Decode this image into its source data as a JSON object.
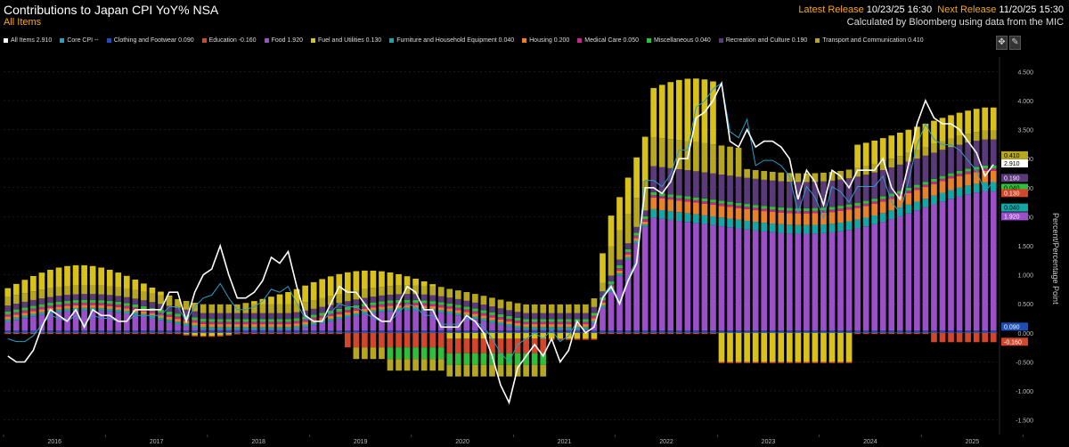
{
  "header": {
    "title": "Contributions to Japan CPI YoY% NSA",
    "subtitle": "All Items",
    "latest_release_label": "Latest Release",
    "latest_release_value": "10/23/25 16:30",
    "next_release_label": "Next Release",
    "next_release_value": "11/20/25 15:30",
    "calc_note": "Calculated by Bloomberg using data from the MIC"
  },
  "tools": {
    "zoom_icon": "crosshair-move-icon",
    "pin_icon": "pin-icon"
  },
  "chart_data": {
    "type": "bar",
    "stacked": true,
    "title": "Contributions to Japan CPI YoY% NSA",
    "ylabel": "Percent/Percentage Point",
    "ylim": [
      -1.75,
      4.75
    ],
    "yticks": [
      -1.5,
      -1.0,
      -0.5,
      0.0,
      0.5,
      1.0,
      1.5,
      2.0,
      2.5,
      3.0,
      3.5,
      4.0,
      4.5
    ],
    "ytick_labels": [
      "-1.500",
      "-1.000",
      "-0.500",
      "0.000",
      "0.500",
      "1.000",
      "1.500",
      "2.000",
      "2.500",
      "3.000",
      "3.500",
      "4.000",
      "4.500"
    ],
    "x_start": "2016-01",
    "x_end": "2025-09",
    "year_labels": [
      "2016",
      "2017",
      "2018",
      "2019",
      "2020",
      "2021",
      "2022",
      "2023",
      "2024",
      "2025"
    ],
    "grid": true,
    "legend_position": "top",
    "legend": [
      {
        "name": "All Items",
        "value": "2.910",
        "color": "#ffffff"
      },
      {
        "name": "Core CPI",
        "value": "--",
        "color": "#27a0c9"
      },
      {
        "name": "Clothing and Footwear",
        "value": "0.090",
        "color": "#1f4fb5"
      },
      {
        "name": "Education",
        "value": "-0.160",
        "color": "#d2462c"
      },
      {
        "name": "Food",
        "value": "1.920",
        "color": "#9b4fc9"
      },
      {
        "name": "Fuel and Utilities",
        "value": "0.130",
        "color": "#d8c21a"
      },
      {
        "name": "Furniture and Household Equipment",
        "value": "0.040",
        "color": "#15a6a6"
      },
      {
        "name": "Housing",
        "value": "0.200",
        "color": "#e8822a"
      },
      {
        "name": "Medical Care",
        "value": "0.050",
        "color": "#c2298f"
      },
      {
        "name": "Miscellaneous",
        "value": "0.040",
        "color": "#2fbf3a"
      },
      {
        "name": "Recreation and Culture",
        "value": "0.190",
        "color": "#5a3a78"
      },
      {
        "name": "Transport and Communication",
        "value": "0.410",
        "color": "#b7a61f"
      }
    ],
    "right_labels": [
      {
        "value": "0.410",
        "color": "#b7a61f",
        "y": 3.05
      },
      {
        "value": "2.910",
        "color": "#ffffff",
        "y": 2.91
      },
      {
        "value": "0.190",
        "color": "#5a3a78",
        "y": 2.66
      },
      {
        "value": "0.040",
        "color": "#2fbf3a",
        "y": 2.49
      },
      {
        "value": "0.130",
        "color": "#d2462c",
        "y": 2.4
      },
      {
        "value": "0.040",
        "color": "#15a6a6",
        "y": 2.15
      },
      {
        "value": "1.920",
        "color": "#9b4fc9",
        "y": 2.0
      },
      {
        "value": "0.090",
        "color": "#1f4fb5",
        "y": 0.1
      },
      {
        "value": "-0.160",
        "color": "#d2462c",
        "y": -0.16
      }
    ],
    "categories_order": [
      "Clothing and Footwear",
      "Food",
      "Furniture and Household Equipment",
      "Housing",
      "Medical Care",
      "Miscellaneous",
      "Recreation and Culture",
      "Fuel and Utilities",
      "Transport and Communication",
      "Education"
    ],
    "all_items": [
      -0.4,
      -0.5,
      -0.5,
      -0.3,
      0.1,
      0.4,
      0.3,
      0.2,
      0.4,
      0.1,
      0.4,
      0.3,
      0.3,
      0.2,
      0.2,
      0.4,
      0.4,
      0.4,
      0.4,
      0.7,
      0.7,
      0.2,
      0.7,
      1.0,
      1.1,
      1.5,
      1.0,
      0.6,
      0.6,
      0.7,
      0.9,
      1.3,
      1.2,
      1.4,
      0.8,
      0.3,
      0.2,
      0.2,
      0.5,
      0.8,
      0.7,
      0.7,
      0.5,
      0.3,
      0.2,
      0.2,
      0.5,
      0.8,
      0.7,
      0.4,
      0.4,
      0.1,
      0.1,
      0.1,
      0.3,
      0.2,
      0.0,
      -0.4,
      -0.9,
      -1.2,
      -0.6,
      -0.4,
      -0.2,
      -0.4,
      -0.1,
      -0.5,
      -0.3,
      0.2,
      0.0,
      0.1,
      0.6,
      0.8,
      0.5,
      0.9,
      1.2,
      2.5,
      2.5,
      2.4,
      2.6,
      3.0,
      3.0,
      3.7,
      3.8,
      4.0,
      4.3,
      3.3,
      3.2,
      3.5,
      3.2,
      3.3,
      3.3,
      3.2,
      3.0,
      2.3,
      2.8,
      2.6,
      2.2,
      2.8,
      2.7,
      2.5,
      2.8,
      2.8,
      2.8,
      3.0,
      2.5,
      2.3,
      2.9,
      3.6,
      4.0,
      3.7,
      3.6,
      3.6,
      3.5,
      3.3,
      3.1,
      2.7,
      2.9
    ]
  }
}
